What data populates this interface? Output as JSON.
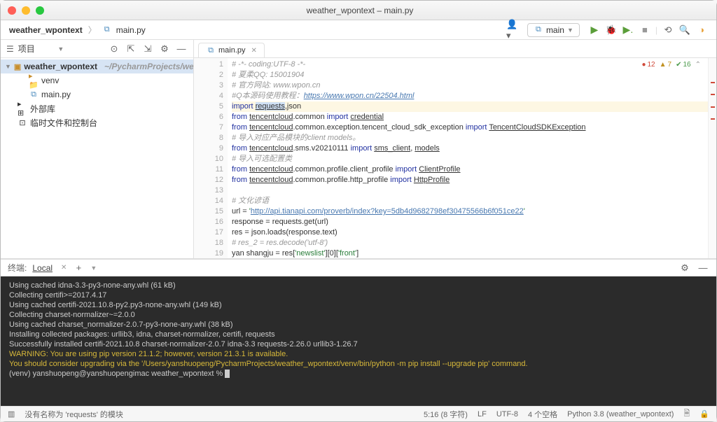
{
  "window": {
    "title": "weather_wpontext – main.py"
  },
  "breadcrumb": {
    "project": "weather_wpontext",
    "file": "main.py"
  },
  "toolbar": {
    "user_icon": "user",
    "run_config": "main"
  },
  "sidebar": {
    "header": "项目",
    "root": {
      "name": "weather_wpontext",
      "path": "~/PycharmProjects/weather_w"
    },
    "items": [
      {
        "name": "venv",
        "icon": "folder",
        "indent": 1
      },
      {
        "name": "main.py",
        "icon": "py",
        "indent": 1
      },
      {
        "name": "外部库",
        "icon": "lib",
        "indent": 0
      },
      {
        "name": "临时文件和控制台",
        "icon": "scratch",
        "indent": 0
      }
    ]
  },
  "editor": {
    "tab": {
      "label": "main.py"
    },
    "problems": {
      "errors": "12",
      "warnings": "7",
      "typos": "16"
    },
    "lines": [
      {
        "n": 1,
        "html": "<span class='c'># -*- coding:UTF-8 -*-</span>"
      },
      {
        "n": 2,
        "html": "<span class='c'># 夏柔QQ: 15001904</span>"
      },
      {
        "n": 3,
        "html": "<span class='c'># 官方网站: www.wpon.cn</span>"
      },
      {
        "n": 4,
        "html": "<span class='c'>#</span><span class='c'>Q本源码使用教程：</span><span class='c link'>https://www.wpon.cn/22504.html</span>"
      },
      {
        "n": 5,
        "hl": true,
        "html": "<span class='k'>import</span> <span class='n sel-word u'>requests</span>,json"
      },
      {
        "n": 6,
        "html": "<span class='k'>from</span> <span class='n u'>tencentcloud</span>.common <span class='k'>import</span> <span class='n u'>credential</span>"
      },
      {
        "n": 7,
        "html": "<span class='k'>from</span> <span class='n u'>tencentcloud</span>.common.exception.tencent_cloud_sdk_exception <span class='k'>import</span> <span class='n u'>TencentCloudSDKException</span>"
      },
      {
        "n": 8,
        "html": "<span class='c'># 导入对应产品模块的client models。</span>"
      },
      {
        "n": 9,
        "html": "<span class='k'>from</span> <span class='n u'>tencentcloud</span>.sms.v20210111 <span class='k'>import</span> <span class='n u'>sms_client</span>, <span class='n u'>models</span>"
      },
      {
        "n": 10,
        "html": "<span class='c'># 导入可选配置类</span>"
      },
      {
        "n": 11,
        "html": "<span class='k'>from</span> <span class='n u'>tencentcloud</span>.common.profile.client_profile <span class='k'>import</span> <span class='n u'>ClientProfile</span>"
      },
      {
        "n": 12,
        "html": "<span class='k'>from</span> <span class='n u'>tencentcloud</span>.common.profile.http_profile <span class='k'>import</span> <span class='n u'>HttpProfile</span>"
      },
      {
        "n": 13,
        "html": ""
      },
      {
        "n": 14,
        "html": "<span class='c'># 文化谚语</span>"
      },
      {
        "n": 15,
        "html": "url = <span class='s'>'<span class='link'>http://api.tianapi.com/proverb/index?key=5db4d9682798ef30475566b6f051ce22</span>'</span>"
      },
      {
        "n": 16,
        "html": "response = requests.get(url)"
      },
      {
        "n": 17,
        "html": "res = json.loads(response.text)"
      },
      {
        "n": 18,
        "html": "<span class='c'># res_2 = res.decode('utf-8')</span>"
      },
      {
        "n": 19,
        "html": "yan shangju = res[<span class='s'>'newslist'</span>][0][<span class='s'>'front'</span>]"
      }
    ]
  },
  "terminal": {
    "header": "终端:",
    "tab": "Local",
    "lines": [
      {
        "t": "  Using cached idna-3.3-py3-none-any.whl (61 kB)"
      },
      {
        "t": "Collecting certifi>=2017.4.17"
      },
      {
        "t": "  Using cached certifi-2021.10.8-py2.py3-none-any.whl (149 kB)"
      },
      {
        "t": "Collecting charset-normalizer~=2.0.0"
      },
      {
        "t": "  Using cached charset_normalizer-2.0.7-py3-none-any.whl (38 kB)"
      },
      {
        "t": "Installing collected packages: urllib3, idna, charset-normalizer, certifi, requests"
      },
      {
        "t": "Successfully installed certifi-2021.10.8 charset-normalizer-2.0.7 idna-3.3 requests-2.26.0 urllib3-1.26.7"
      },
      {
        "t": "WARNING: You are using pip version 21.1.2; however, version 21.3.1 is available.",
        "cls": "w"
      },
      {
        "t": "You should consider upgrading via the '/Users/yanshuopeng/PycharmProjects/weather_wpontext/venv/bin/python -m pip install --upgrade pip' command.",
        "cls": "w"
      }
    ],
    "prompt": "(venv) yanshuopeng@yanshuopengimac weather_wpontext % "
  },
  "statusbar": {
    "message": "没有名称为 'requests' 的模块",
    "pos": "5:16 (8 字符)",
    "sep": "LF",
    "enc": "UTF-8",
    "indent": "4 个空格",
    "interpreter": "Python 3.8 (weather_wpontext)"
  }
}
